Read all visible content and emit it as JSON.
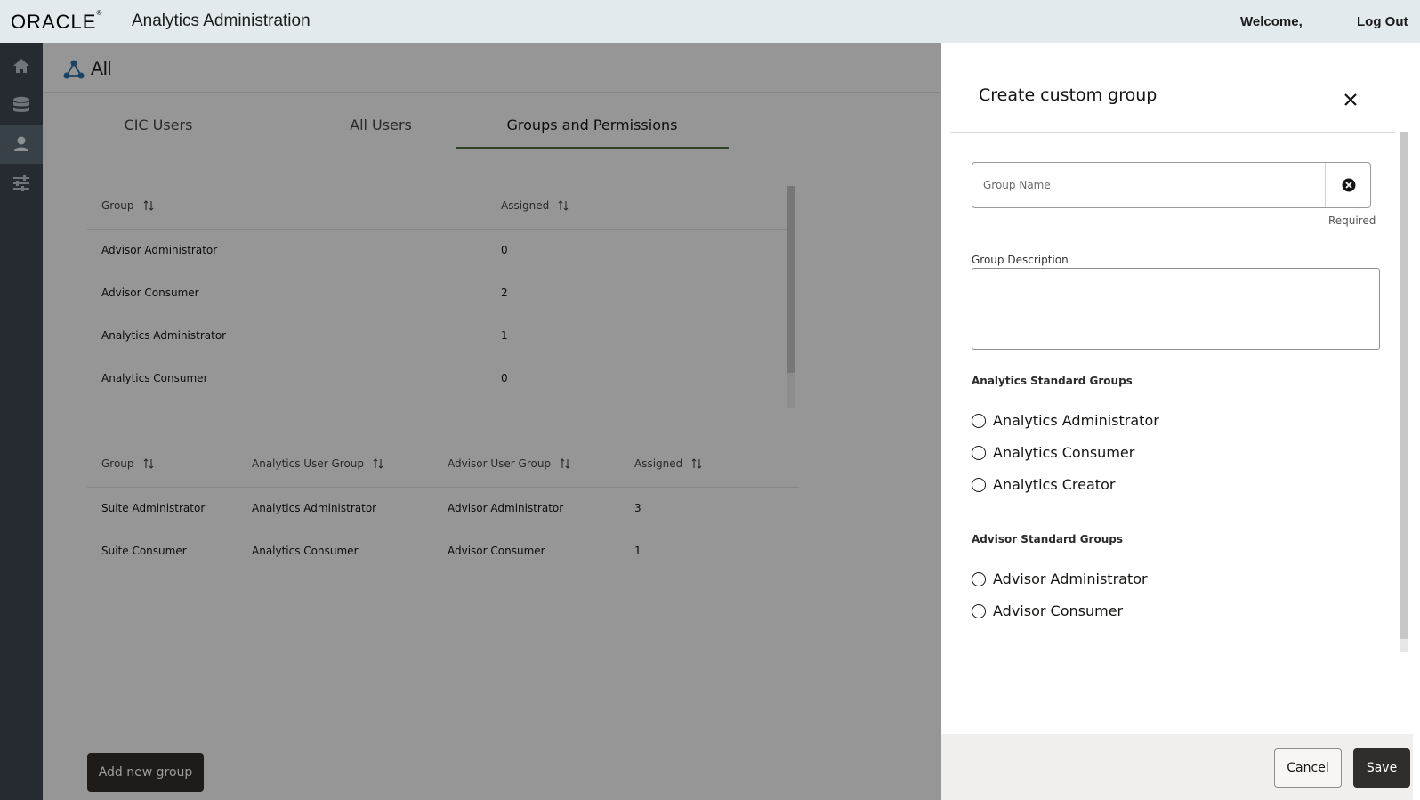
{
  "header": {
    "logo": "ORACLE",
    "app_title": "Analytics Administration",
    "welcome": "Welcome,",
    "logout": "Log Out"
  },
  "rail": {
    "items": [
      {
        "icon": "home-icon",
        "active": false
      },
      {
        "icon": "database-icon",
        "active": false
      },
      {
        "icon": "user-icon",
        "active": true
      },
      {
        "icon": "sliders-icon",
        "active": false
      }
    ]
  },
  "main": {
    "breadcrumb": "All",
    "tabs": [
      {
        "label": "CIC Users",
        "active": false
      },
      {
        "label": "All Users",
        "active": false
      },
      {
        "label": "Groups and Permissions",
        "active": true
      }
    ],
    "standard_groups_table": {
      "columns": [
        "Group",
        "Assigned"
      ],
      "rows": [
        [
          "Advisor Administrator",
          "0"
        ],
        [
          "Advisor Consumer",
          "2"
        ],
        [
          "Analytics Administrator",
          "1"
        ],
        [
          "Analytics Consumer",
          "0"
        ]
      ]
    },
    "suite_groups_table": {
      "columns": [
        "Group",
        "Analytics User Group",
        "Advisor User Group",
        "Assigned"
      ],
      "rows": [
        [
          "Suite Administrator",
          "Analytics Administrator",
          "Advisor Administrator",
          "3"
        ],
        [
          "Suite Consumer",
          "Analytics Consumer",
          "Advisor Consumer",
          "1"
        ]
      ]
    },
    "add_button": "Add new group"
  },
  "drawer": {
    "title": "Create custom group",
    "group_name": {
      "placeholder": "Group Name",
      "value": "",
      "hint": "Required"
    },
    "group_description": {
      "label": "Group Description",
      "value": ""
    },
    "analytics_section": "Analytics Standard Groups",
    "analytics_options": [
      "Analytics Administrator",
      "Analytics Consumer",
      "Analytics Creator"
    ],
    "advisor_section": "Advisor Standard Groups",
    "advisor_options": [
      "Advisor Administrator",
      "Advisor Consumer"
    ],
    "cancel": "Cancel",
    "save": "Save"
  },
  "colors": {
    "header_bg": "#e3eaed",
    "rail_bg": "#3d4751",
    "tab_underline": "#4e6c3d",
    "primary_button": "#312d2a",
    "accent_blue": "#2c6ea6"
  }
}
